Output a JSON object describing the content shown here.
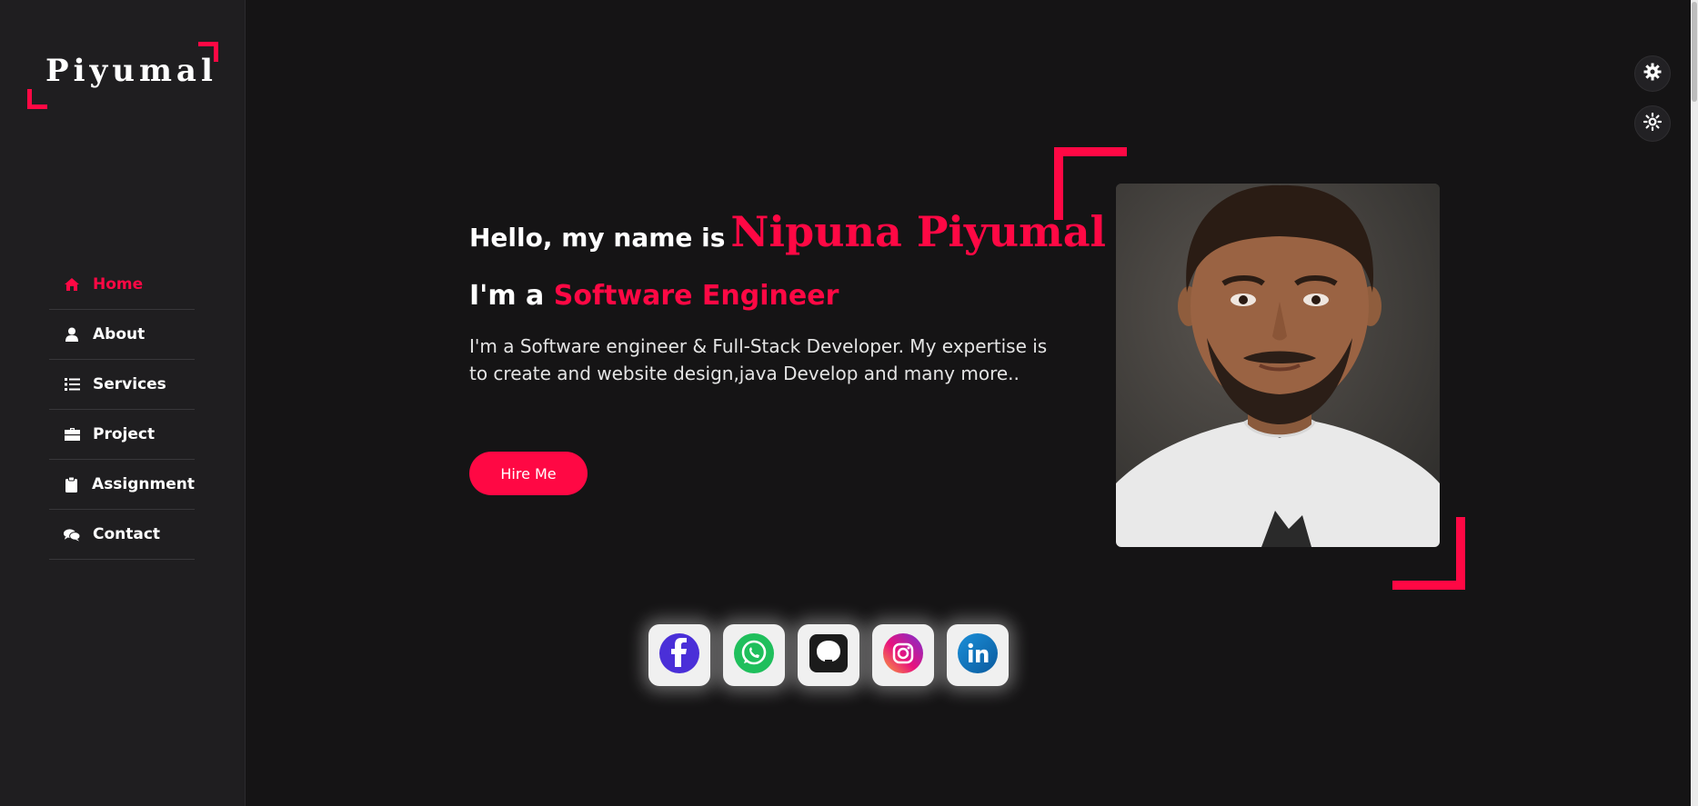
{
  "brand": {
    "logo_text": "Piyumal",
    "accent_color": "#ff0844"
  },
  "nav": {
    "items": [
      {
        "label": "Home",
        "icon": "home-icon",
        "active": true
      },
      {
        "label": "About",
        "icon": "user-icon",
        "active": false
      },
      {
        "label": "Services",
        "icon": "list-icon",
        "active": false
      },
      {
        "label": "Project",
        "icon": "briefcase-icon",
        "active": false
      },
      {
        "label": "Assignment",
        "icon": "clipboard-icon",
        "active": false
      },
      {
        "label": "Contact",
        "icon": "comments-icon",
        "active": false
      }
    ]
  },
  "toolbar": {
    "settings_icon": "gear-icon",
    "theme_icon": "sun-icon"
  },
  "hero": {
    "greeting": "Hello, my name is",
    "name": "Nipuna Piyumal",
    "role_prefix": "I'm a",
    "role": "Software Engineer",
    "description": "I'm a Software engineer & Full-Stack Developer. My expertise is to create and website design,java Develop and many more..",
    "hire_label": "Hire Me"
  },
  "social": {
    "items": [
      {
        "name": "facebook",
        "icon": "facebook-icon"
      },
      {
        "name": "whatsapp",
        "icon": "whatsapp-icon"
      },
      {
        "name": "github",
        "icon": "github-icon"
      },
      {
        "name": "instagram",
        "icon": "instagram-icon"
      },
      {
        "name": "linkedin",
        "icon": "linkedin-icon"
      }
    ]
  }
}
